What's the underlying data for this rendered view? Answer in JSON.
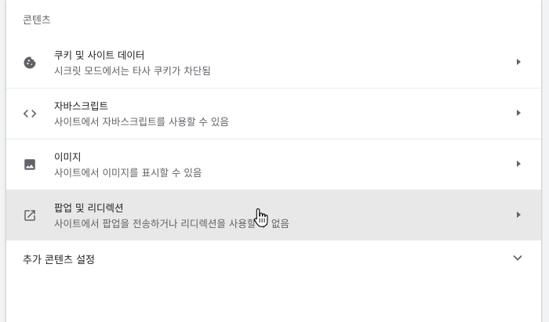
{
  "section_title": "콘텐츠",
  "rows": [
    {
      "title": "쿠키 및 사이트 데이터",
      "subtitle": "시크릿 모드에서는 타사 쿠키가 차단됨",
      "icon": "cookie-icon"
    },
    {
      "title": "자바스크립트",
      "subtitle": "사이트에서 자바스크립트를 사용할 수 있음",
      "icon": "code-icon"
    },
    {
      "title": "이미지",
      "subtitle": "사이트에서 이미지를 표시할 수 있음",
      "icon": "image-icon"
    },
    {
      "title": "팝업 및 리디렉션",
      "subtitle": "사이트에서 팝업을 전송하거나 리디렉션을 사용할 수 없음",
      "icon": "open-in-new-icon"
    }
  ],
  "more_settings": {
    "label": "추가 콘텐츠 설정",
    "icon": "chevron-down-icon"
  },
  "colors": {
    "icon": "#5f6368",
    "hover_row": "#e8e8e8"
  }
}
